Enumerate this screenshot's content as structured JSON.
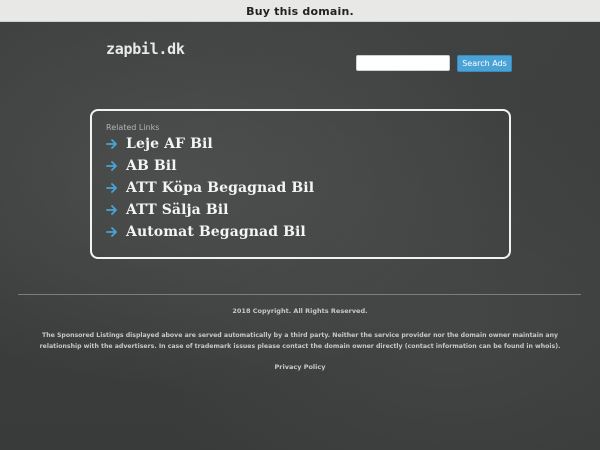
{
  "topbar": {
    "buy_label": "Buy this domain."
  },
  "header": {
    "domain": "zapbil.dk",
    "search_placeholder": "",
    "search_button": "Search Ads"
  },
  "related": {
    "heading": "Related Links",
    "items": [
      {
        "label": "Leje AF Bil"
      },
      {
        "label": "AB Bil"
      },
      {
        "label": "ATT Köpa Begagnad Bil"
      },
      {
        "label": "ATT Sälja Bil"
      },
      {
        "label": "Automat Begagnad Bil"
      }
    ],
    "arrow_icon": "arrow-right-icon",
    "arrow_color": "#4aa3d6"
  },
  "footer": {
    "copyright": "2018 Copyright. All Rights Reserved.",
    "disclaimer": "The Sponsored Listings displayed above are served automatically by a third party. Neither the service provider nor the domain owner maintain any relationship with the advertisers. In case of trademark issues please contact the domain owner directly (contact information can be found in whois).",
    "privacy": "Privacy Policy"
  },
  "colors": {
    "background": "#3b3d3d",
    "accent": "#4aa3d6"
  }
}
